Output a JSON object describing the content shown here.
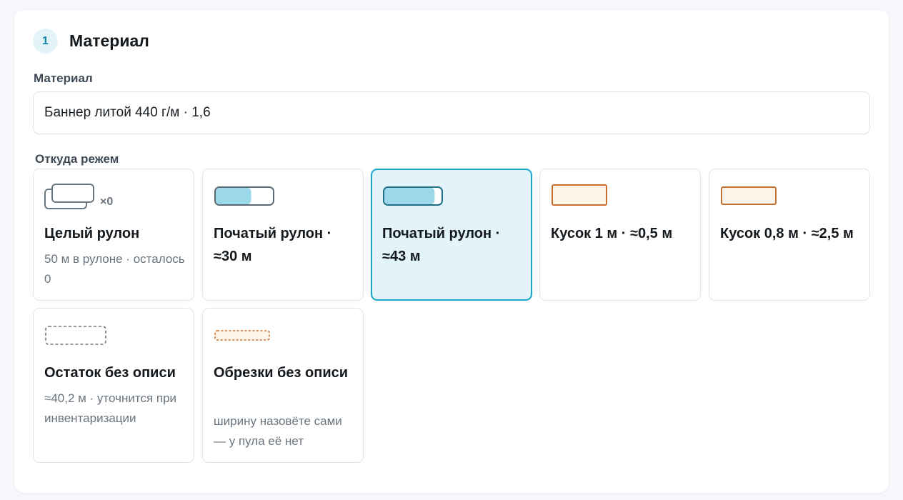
{
  "section": {
    "step_number": "1",
    "title": "Материал"
  },
  "material": {
    "label": "Материал",
    "value": "Баннер литой 440 г/м · 1,6"
  },
  "source": {
    "label": "Откуда режем",
    "options": [
      {
        "title": "Целый рулон",
        "subtitle": "50 м в рулоне · осталось 0",
        "count": "×0",
        "icon": "full-roll-icon",
        "selected": false
      },
      {
        "title": "Початый рулон · ≈30 м",
        "subtitle": "",
        "icon": "partial-roll-icon",
        "fill_fraction": 0.62,
        "selected": false
      },
      {
        "title": "Початый рулон · ≈43 м",
        "subtitle": "",
        "icon": "partial-roll-icon",
        "fill_fraction": 0.88,
        "selected": true
      },
      {
        "title": "Кусок 1 м · ≈0,5 м",
        "subtitle": "",
        "icon": "piece-icon",
        "selected": false
      },
      {
        "title": "Кусок 0,8 м · ≈2,5 м",
        "subtitle": "",
        "icon": "piece-icon",
        "selected": false
      },
      {
        "title": "Остаток без описи",
        "subtitle": "≈40,2 м · уточнится при инвентаризации",
        "icon": "remnant-icon",
        "selected": false
      },
      {
        "title": "Обрезки без описи",
        "subtitle": "ширину назовёте сами — у пула её нет",
        "icon": "scraps-icon",
        "selected": false
      }
    ]
  },
  "colors": {
    "accent": "#19a6c8",
    "selected_bg": "#e2f4fa",
    "roll_fill": "#9ad8ea",
    "piece_border": "#c96f2e",
    "piece_fill": "#fff4e8"
  }
}
